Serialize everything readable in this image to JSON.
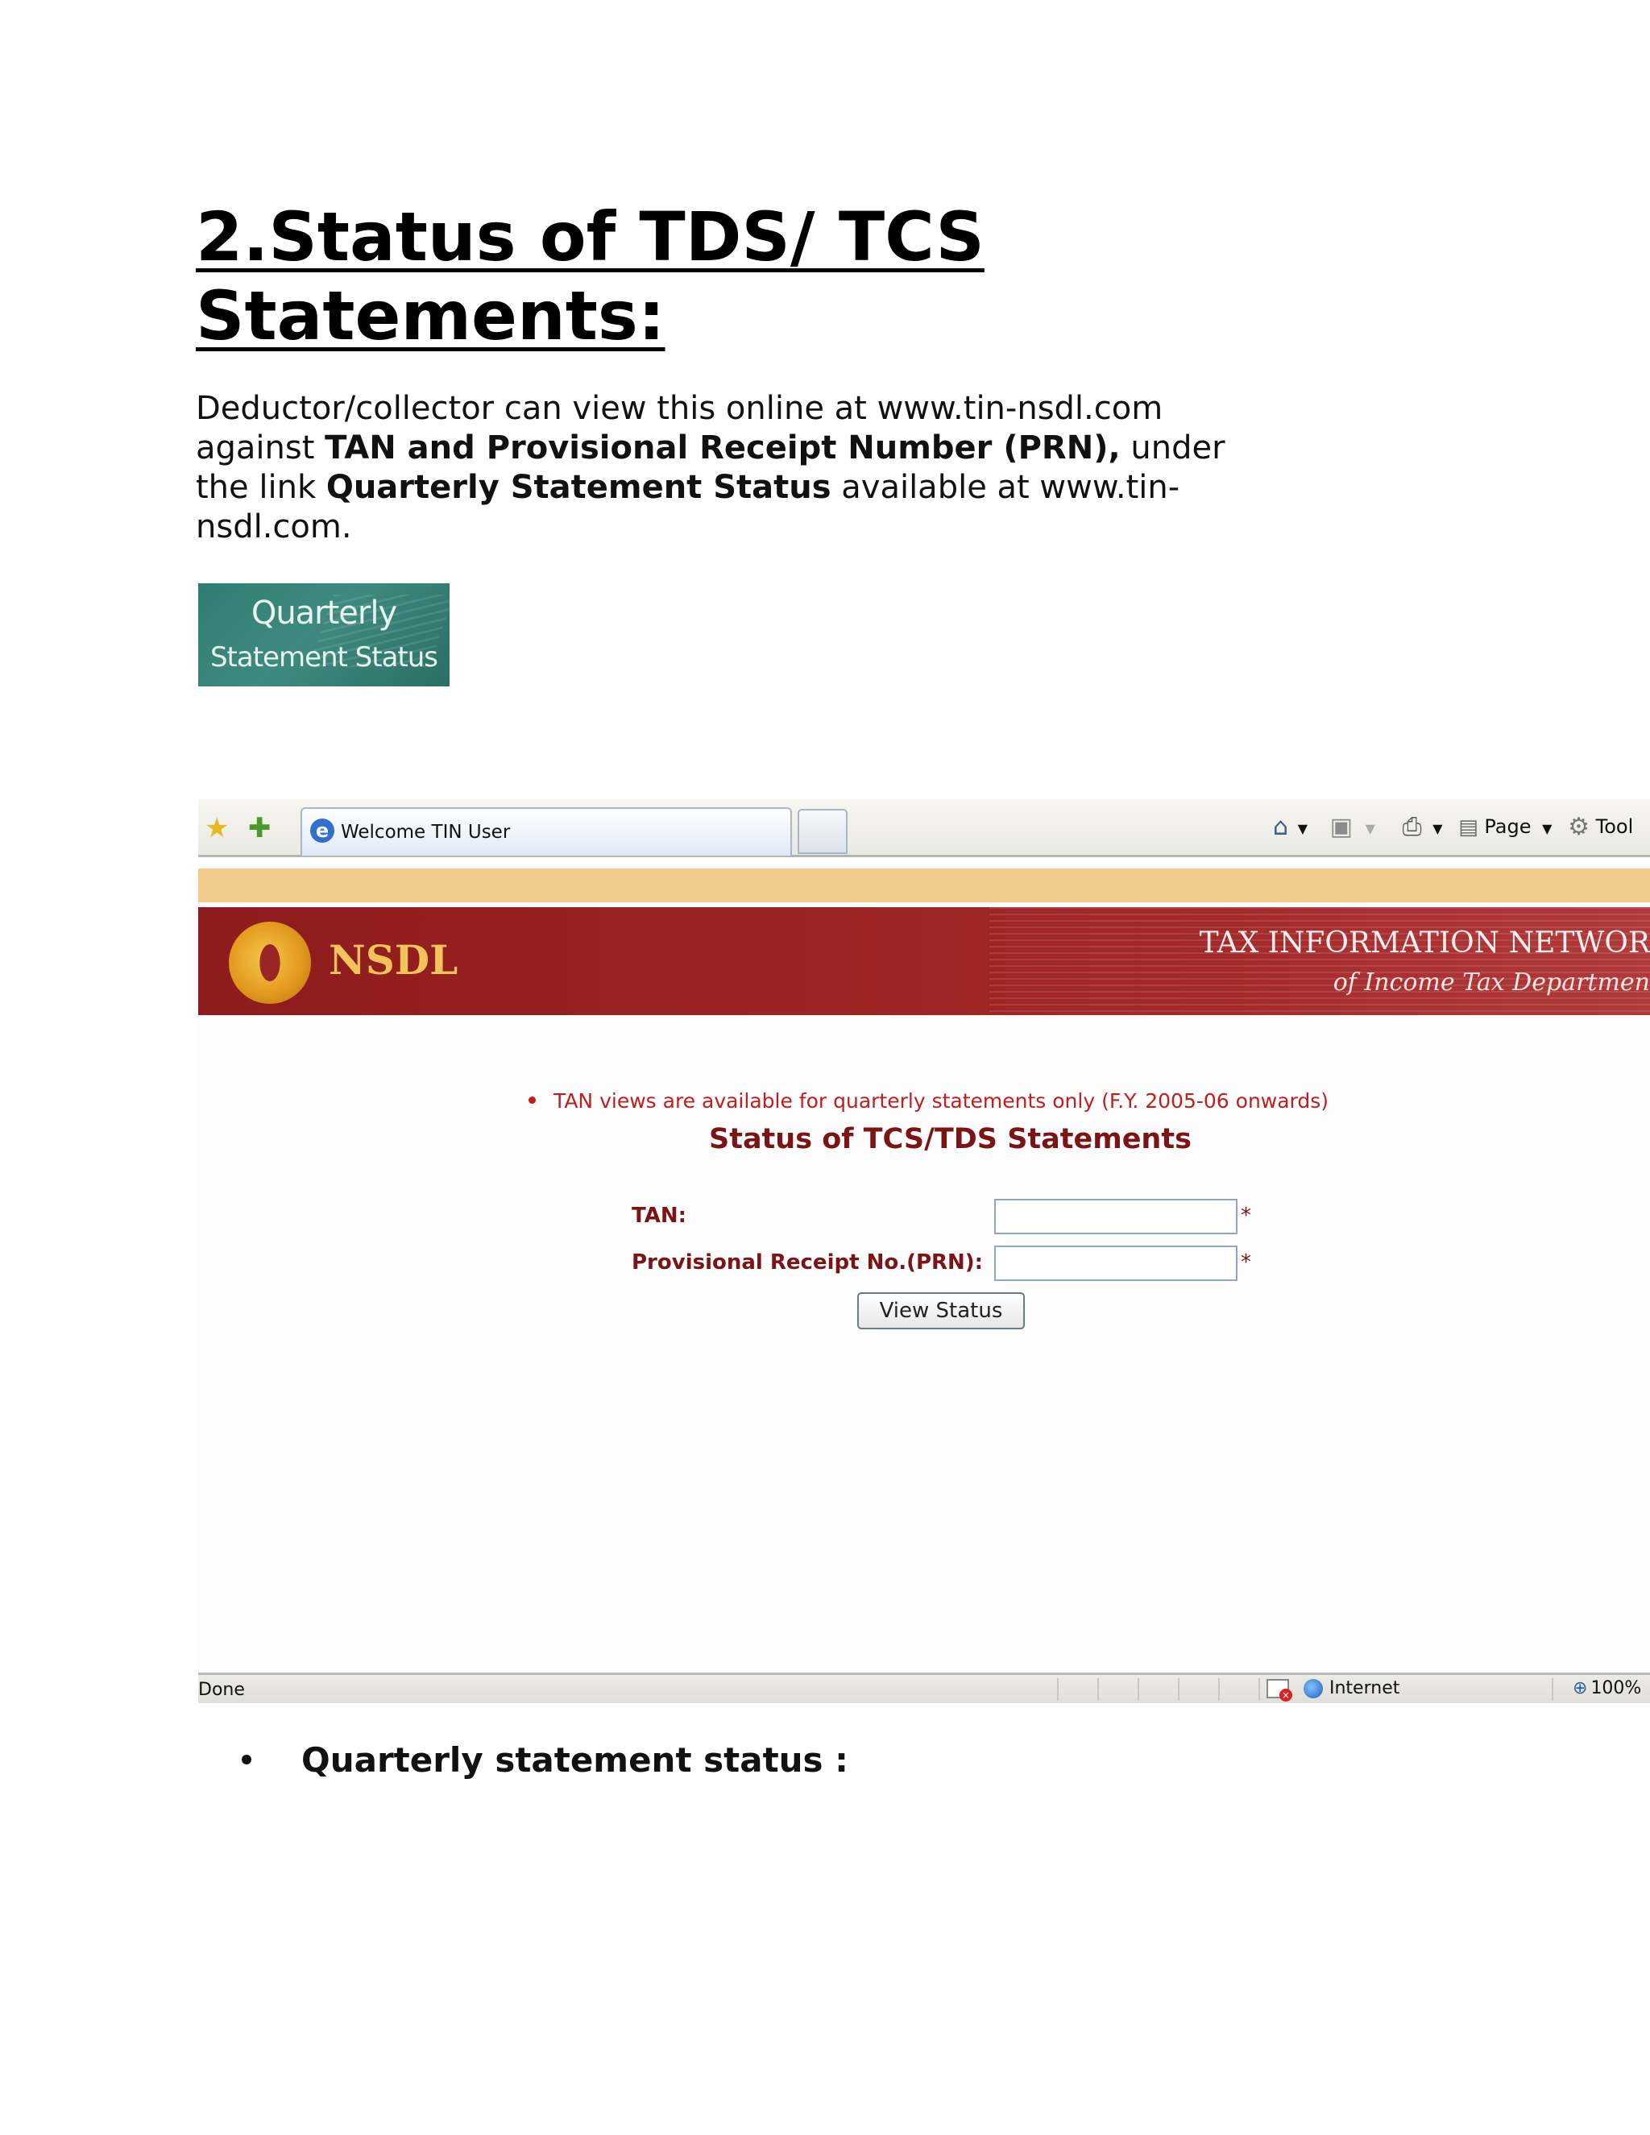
{
  "heading": {
    "line1": "2.Status of TDS/ TCS",
    "line2": "Statements:"
  },
  "intro": {
    "t1": "Deductor/collector can view this online at www.tin-nsdl.com against ",
    "b1": "TAN and Provisional Receipt Number (PRN),",
    "t2": " under the link ",
    "b2": "Quarterly Statement Status",
    "t3": " available at www.tin-nsdl.com."
  },
  "banner": {
    "line1": "Quarterly",
    "line2": "Statement Status"
  },
  "browser": {
    "tab_title": "Welcome TIN User",
    "toolbar": {
      "page_label": "Page",
      "tools_label": "Tool"
    },
    "header": {
      "brand": "NSDL",
      "tin_line1": "TAX INFORMATION NETWOR",
      "tin_line2": "of Income Tax Departmen"
    },
    "form": {
      "notice": "TAN views are available for quarterly statements only (F.Y. 2005-06 onwards)",
      "title": "Status of TCS/TDS Statements",
      "tan_label": "TAN:",
      "prn_label": "Provisional Receipt No.(PRN):",
      "required_mark": "*",
      "tan_value": "",
      "prn_value": "",
      "button": "View Status"
    },
    "statusbar": {
      "status": "Done",
      "zone": "Internet",
      "zoom": "100%"
    }
  },
  "bullet": {
    "text": "Quarterly statement status :"
  }
}
